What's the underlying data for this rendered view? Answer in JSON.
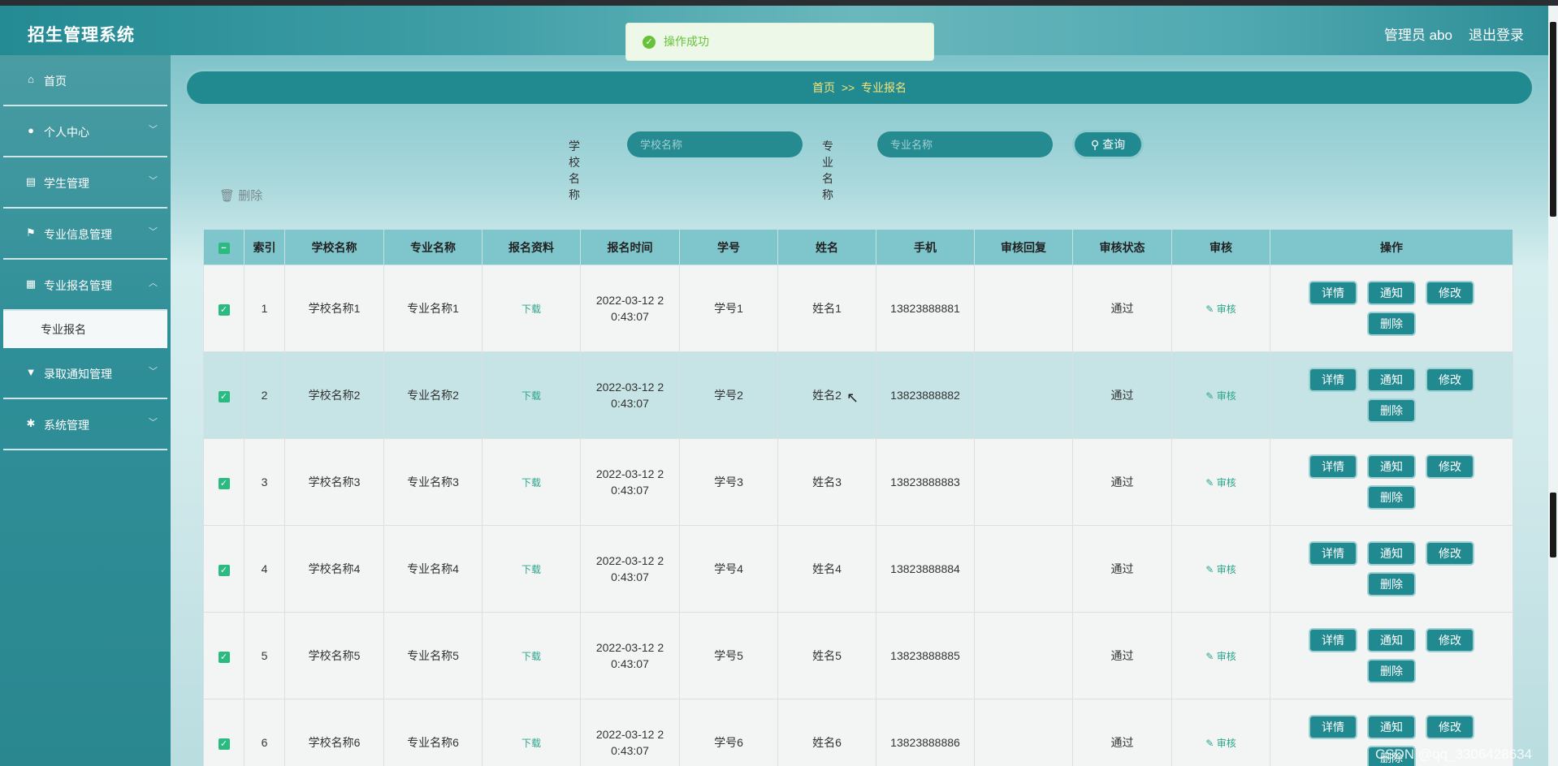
{
  "header": {
    "title": "招生管理系统",
    "user": "管理员 abo",
    "logout": "退出登录"
  },
  "toast": {
    "message": "操作成功"
  },
  "sidebar": {
    "items": [
      {
        "label": "首页",
        "icon": "home-icon"
      },
      {
        "label": "个人中心",
        "icon": "user-icon"
      },
      {
        "label": "学生管理",
        "icon": "clipboard-icon"
      },
      {
        "label": "专业信息管理",
        "icon": "flag-icon"
      },
      {
        "label": "专业报名管理",
        "icon": "grid-icon"
      },
      {
        "label": "录取通知管理",
        "icon": "notice-icon"
      },
      {
        "label": "系统管理",
        "icon": "settings-icon"
      }
    ],
    "active_sub": "专业报名"
  },
  "breadcrumb": {
    "home": "首页",
    "sep": ">>",
    "current": "专业报名"
  },
  "search": {
    "school_label": "学校名称",
    "school_placeholder": "学校名称",
    "major_label": "专业名称",
    "major_placeholder": "专业名称",
    "query_button": "查询"
  },
  "toolbar": {
    "delete_label": "删除"
  },
  "table": {
    "headers": [
      "索引",
      "学校名称",
      "专业名称",
      "报名资料",
      "报名时间",
      "学号",
      "姓名",
      "手机",
      "审核回复",
      "审核状态",
      "审核",
      "操作"
    ],
    "download_label": "下载",
    "audit_label": "审核",
    "buttons": {
      "detail": "详情",
      "notify": "通知",
      "edit": "修改",
      "delete": "删除"
    },
    "rows": [
      {
        "index": "1",
        "school": "学校名称1",
        "major": "专业名称1",
        "time_a": "2022-03-12 2",
        "time_b": "0:43:07",
        "sid": "学号1",
        "name": "姓名1",
        "phone": "13823888881",
        "reply": "",
        "status": "通过"
      },
      {
        "index": "2",
        "school": "学校名称2",
        "major": "专业名称2",
        "time_a": "2022-03-12 2",
        "time_b": "0:43:07",
        "sid": "学号2",
        "name": "姓名2",
        "phone": "13823888882",
        "reply": "",
        "status": "通过"
      },
      {
        "index": "3",
        "school": "学校名称3",
        "major": "专业名称3",
        "time_a": "2022-03-12 2",
        "time_b": "0:43:07",
        "sid": "学号3",
        "name": "姓名3",
        "phone": "13823888883",
        "reply": "",
        "status": "通过"
      },
      {
        "index": "4",
        "school": "学校名称4",
        "major": "专业名称4",
        "time_a": "2022-03-12 2",
        "time_b": "0:43:07",
        "sid": "学号4",
        "name": "姓名4",
        "phone": "13823888884",
        "reply": "",
        "status": "通过"
      },
      {
        "index": "5",
        "school": "学校名称5",
        "major": "专业名称5",
        "time_a": "2022-03-12 2",
        "time_b": "0:43:07",
        "sid": "学号5",
        "name": "姓名5",
        "phone": "13823888885",
        "reply": "",
        "status": "通过"
      },
      {
        "index": "6",
        "school": "学校名称6",
        "major": "专业名称6",
        "time_a": "2022-03-12 2",
        "time_b": "0:43:07",
        "sid": "学号6",
        "name": "姓名6",
        "phone": "13823888886",
        "reply": "",
        "status": "通过"
      }
    ]
  },
  "watermark": "CSDN @qq_3306428634"
}
